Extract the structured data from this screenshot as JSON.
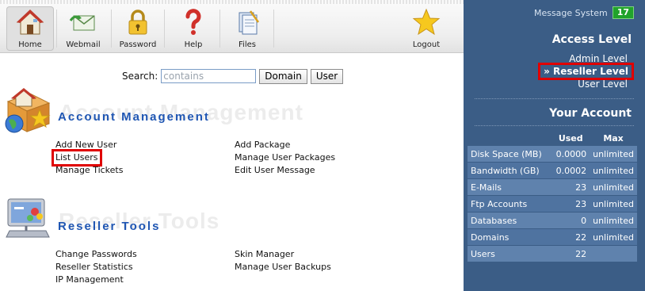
{
  "toolbar": {
    "items": [
      {
        "label": "Home",
        "icon": "house-icon"
      },
      {
        "label": "Webmail",
        "icon": "envelope-icon"
      },
      {
        "label": "Password",
        "icon": "padlock-icon"
      },
      {
        "label": "Help",
        "icon": "question-mark-icon"
      },
      {
        "label": "Files",
        "icon": "files-icon"
      },
      {
        "label": "Logout",
        "icon": "star-icon"
      }
    ]
  },
  "search": {
    "label": "Search:",
    "placeholder": "contains",
    "domain_button": "Domain",
    "user_button": "User"
  },
  "account_management": {
    "title": "Account Management",
    "watermark": "Account Management",
    "col1": [
      "Add New User",
      "List Users",
      "Manage Tickets"
    ],
    "col2": [
      "Add Package",
      "Manage User Packages",
      "Edit User Message"
    ]
  },
  "reseller_tools": {
    "title": "Reseller Tools",
    "watermark": "Reseller Tools",
    "col1": [
      "Change Passwords",
      "Reseller Statistics",
      "IP Management"
    ],
    "col2": [
      "Skin Manager",
      "Manage User Backups"
    ]
  },
  "right_panel": {
    "message_system_label": "Message System",
    "message_count": "17",
    "access_level_title": "Access Level",
    "levels": {
      "admin": "Admin Level",
      "reseller": "» Reseller Level",
      "user": "User Level"
    },
    "your_account_title": "Your Account",
    "usage_headers": {
      "used": "Used",
      "max": "Max"
    },
    "usage_rows": [
      {
        "name": "Disk Space (MB)",
        "used": "0.0000",
        "max": "unlimited"
      },
      {
        "name": "Bandwidth (GB)",
        "used": "0.0002",
        "max": "unlimited"
      },
      {
        "name": "E-Mails",
        "used": "23",
        "max": "unlimited"
      },
      {
        "name": "Ftp Accounts",
        "used": "23",
        "max": "unlimited"
      },
      {
        "name": "Databases",
        "used": "0",
        "max": "unlimited"
      },
      {
        "name": "Domains",
        "used": "22",
        "max": "unlimited"
      },
      {
        "name": "Users",
        "used": "22",
        "max": ""
      }
    ]
  },
  "colors": {
    "panel_bg": "#3b5d86",
    "highlight_box": "#e00000",
    "section_title": "#1f56b3",
    "badge": "#21a32b"
  }
}
